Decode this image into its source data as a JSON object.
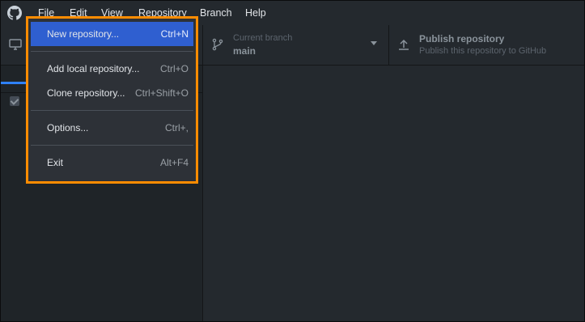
{
  "menubar": {
    "items": [
      "File",
      "Edit",
      "View",
      "Repository",
      "Branch",
      "Help"
    ]
  },
  "toolbar": {
    "branch": {
      "label": "Current branch",
      "value": "main"
    },
    "publish": {
      "title": "Publish repository",
      "subtitle": "Publish this repository to GitHub"
    }
  },
  "file_menu": {
    "items": [
      {
        "label": "New repository...",
        "accelerator": "Ctrl+N"
      },
      {
        "label": "Add local repository...",
        "accelerator": "Ctrl+O"
      },
      {
        "label": "Clone repository...",
        "accelerator": "Ctrl+Shift+O"
      },
      {
        "label": "Options...",
        "accelerator": "Ctrl+,"
      },
      {
        "label": "Exit",
        "accelerator": "Alt+F4"
      }
    ],
    "selected_item": "New repository...",
    "highlight_color": "#ff8c00",
    "selection_color": "#2f5fd0"
  },
  "icons": {
    "app": "github-icon",
    "repository": "desktop-icon",
    "branch": "git-branch-icon",
    "publish": "upload-icon",
    "caret": "chevron-down-icon",
    "checkbox": "checkbox-icon"
  }
}
